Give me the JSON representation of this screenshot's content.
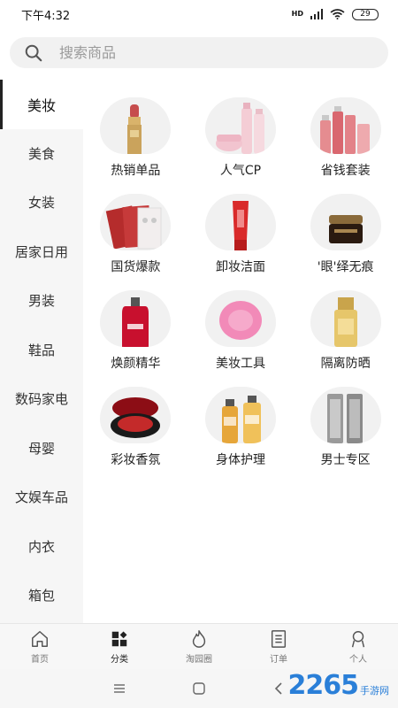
{
  "status": {
    "time": "下午4:32",
    "network": "HD",
    "battery": "29"
  },
  "search": {
    "placeholder": "搜索商品"
  },
  "sidebar": {
    "items": [
      {
        "label": "美妆",
        "active": true
      },
      {
        "label": "美食"
      },
      {
        "label": "女装"
      },
      {
        "label": "居家日用"
      },
      {
        "label": "男装"
      },
      {
        "label": "鞋品"
      },
      {
        "label": "数码家电"
      },
      {
        "label": "母婴"
      },
      {
        "label": "文娱车品"
      },
      {
        "label": "内衣"
      },
      {
        "label": "箱包"
      }
    ]
  },
  "grid": {
    "items": [
      {
        "label": "热销单品",
        "icon": "lipstick-image"
      },
      {
        "label": "人气CP",
        "icon": "skincare-set-image"
      },
      {
        "label": "省钱套装",
        "icon": "serum-bottles-image"
      },
      {
        "label": "国货爆款",
        "icon": "face-mask-image"
      },
      {
        "label": "卸妆洁面",
        "icon": "cleanser-tube-image"
      },
      {
        "label": "'眼'绎无痕",
        "icon": "eye-cream-image"
      },
      {
        "label": "焕颜精华",
        "icon": "essence-bottle-image"
      },
      {
        "label": "美妆工具",
        "icon": "cleansing-brush-image"
      },
      {
        "label": "隔离防晒",
        "icon": "sunscreen-image"
      },
      {
        "label": "彩妆香氛",
        "icon": "cushion-compact-image"
      },
      {
        "label": "身体护理",
        "icon": "body-care-bottles-image"
      },
      {
        "label": "男士专区",
        "icon": "mens-bottles-image"
      }
    ]
  },
  "bottom_nav": {
    "items": [
      {
        "label": "首页",
        "icon": "home-icon"
      },
      {
        "label": "分类",
        "icon": "category-icon",
        "active": true
      },
      {
        "label": "淘园圈",
        "icon": "flame-icon"
      },
      {
        "label": "订单",
        "icon": "order-icon"
      },
      {
        "label": "个人",
        "icon": "person-icon"
      }
    ]
  },
  "watermark": {
    "big": "2265",
    "small": "手游网"
  }
}
